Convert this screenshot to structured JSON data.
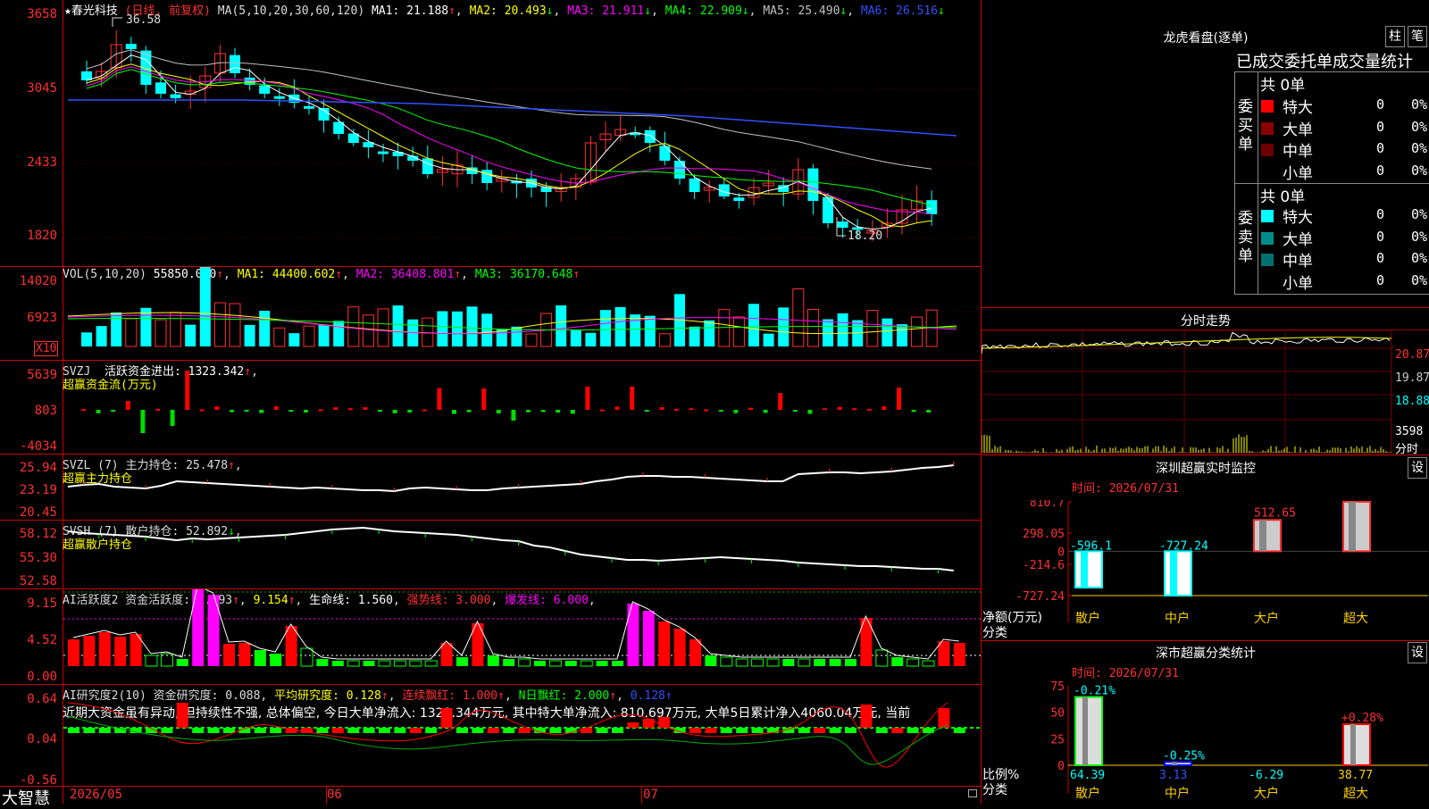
{
  "stock": {
    "name": "★春光科技",
    "period": "(日线, 前复权)",
    "ma_title": "MA(5,10,20,30,60,120)",
    "ma": [
      {
        "label": "MA1: 21.188",
        "arrow": "↑",
        "color": "#ffffff"
      },
      {
        "label": "MA2: 20.493",
        "arrow": "↓",
        "color": "#ffff00"
      },
      {
        "label": "MA3: 21.911",
        "arrow": "↓",
        "color": "#ff00ff"
      },
      {
        "label": "MA4: 22.909",
        "arrow": "↓",
        "color": "#00ff00"
      },
      {
        "label": "MA5: 25.490",
        "arrow": "↓",
        "color": "#c0c0c0"
      },
      {
        "label": "MA6: 26.516",
        "arrow": "↓",
        "color": "#3050ff"
      }
    ],
    "high_label": "36.58",
    "low_label": "18.20",
    "y_ticks": [
      "3658",
      "3045",
      "2433",
      "1820"
    ]
  },
  "vol": {
    "header": "VOL(5,10,20)",
    "value": "55850.000",
    "ma1": "MA1: 44400.602",
    "ma2": "MA2: 36408.801",
    "ma3": "MA3: 36170.648",
    "arrow": "↑",
    "y_ticks": [
      "14020",
      "6923"
    ],
    "unit": "X10"
  },
  "svzj": {
    "header": "SVZJ",
    "field": "活跃资金进出: 1323.342",
    "arrow": "↑",
    "sub": "超赢资金流(万元)",
    "y_ticks": [
      "5639",
      "803",
      "-4034"
    ]
  },
  "svzl": {
    "header": "SVZL (7) 主力持仓: 25.478",
    "arrow": "↑",
    "sub": "超赢主力持仓",
    "y_ticks": [
      "25.94",
      "23.19",
      "20.45"
    ]
  },
  "svsh": {
    "header": "SVSH (7) 散户持仓: 52.892",
    "arrow": "↓",
    "sub": "超赢散户持仓",
    "y_ticks": [
      "58.12",
      "55.30",
      "52.58"
    ]
  },
  "ai2": {
    "header": "AI活跃度2 资金活跃度: 3.693",
    "v2": "9.154",
    "life": "生命线: 1.560",
    "strong": "强势线: 3.000",
    "burst": "爆发线: 6.000",
    "y_ticks": [
      "9.15",
      "4.52",
      "0.00"
    ]
  },
  "ai_r": {
    "header": "AI研究度2(10) 资金研究度: 0.088",
    "avg": "平均研究度: 0.128",
    "cont": "连续飘红: 1.000",
    "nday": "N日飘红: 2.000",
    "last": "0.128",
    "comment": "近期大资金虽有异动, 但持续性不强, 总体偏空, 今日大单净流入: 1323.344万元, 其中特大单净流入: 810.697万元, 大单5日累计净入4060.04万元, 当前",
    "y_ticks": [
      "0.64",
      "0.04",
      "-0.56"
    ]
  },
  "footer": {
    "brand": "大智慧",
    "dates": [
      "2026/05",
      "06",
      "07"
    ]
  },
  "dragon": {
    "title": "龙虎看盘(逐单)",
    "btn_zhu": "柱",
    "btn_bi": "笔",
    "subtitle": "已成交委托单成交量统计",
    "buy_side": "委买单",
    "sell_side": "委卖单",
    "buy_total": "共 0单",
    "sell_total": "共 0单",
    "rows": [
      "特大",
      "大单",
      "中单",
      "小单"
    ],
    "count": "0",
    "pct": "0%",
    "buy_colors": [
      "#ff0000",
      "#8b0000",
      "#6b0000"
    ],
    "sell_colors": [
      "#00ffff",
      "#008b8b",
      "#006f6f"
    ]
  },
  "intraday": {
    "title": "分时走势",
    "y_ticks": [
      "20.87",
      "19.87",
      "18.88"
    ],
    "vol_tick": "3598",
    "vol_unit": "分时"
  },
  "sz_monitor": {
    "title": "深圳超赢实时监控",
    "btn": "设",
    "time": "时间: 2026/07/31",
    "y_ticks": [
      "810.7",
      "298.05",
      "0",
      "-214.6",
      "-727.24"
    ],
    "ylabel1": "净额(万元)",
    "ylabel2": "分类",
    "categories": [
      "散户",
      "中户",
      "大户",
      "超大"
    ],
    "values": [
      "-596.1",
      "-727.24",
      "512.65",
      "810.7"
    ]
  },
  "sz_class": {
    "title": "深市超赢分类统计",
    "btn": "设",
    "time": "时间: 2026/07/31",
    "y_ticks": [
      "75",
      "50",
      "25",
      "0"
    ],
    "ylabel1": "比例%",
    "ylabel2": "分类",
    "categories": [
      "散户",
      "中户",
      "大户",
      "超大"
    ],
    "top_labels": [
      "-0.21%",
      "-0.25%",
      "",
      "+0.28%"
    ],
    "bottom_labels": [
      "64.39",
      "3.13",
      "-6.29",
      "38.77"
    ]
  },
  "chart_data": [
    {
      "type": "bar",
      "title": "深圳超赢实时监控",
      "ylabel": "净额(万元)",
      "xlabel": "分类",
      "categories": [
        "散户",
        "中户",
        "大户",
        "超大"
      ],
      "values": [
        -596.1,
        -727.24,
        512.65,
        810.7
      ],
      "ylim": [
        -727.24,
        810.7
      ]
    },
    {
      "type": "bar",
      "title": "深市超赢分类统计",
      "ylabel": "比例%",
      "xlabel": "分类",
      "categories": [
        "散户",
        "中户",
        "大户",
        "超大"
      ],
      "values": [
        64.39,
        3.13,
        -6.29,
        38.77
      ],
      "ylim": [
        0,
        75
      ]
    }
  ]
}
